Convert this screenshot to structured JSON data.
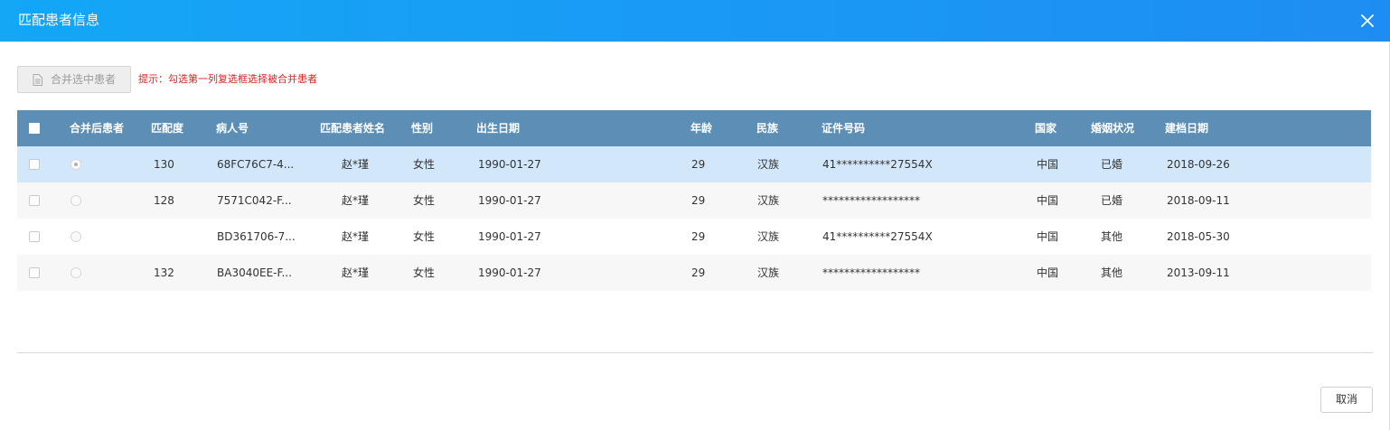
{
  "dialog": {
    "title": "匹配患者信息",
    "close_icon": "close-icon"
  },
  "toolbar": {
    "merge_label": "合并选中患者",
    "merge_icon": "document-icon",
    "hint": "提示：勾选第一列复选框选择被合并患者"
  },
  "table": {
    "headers": {
      "merged": "合并后患者",
      "match": "匹配度",
      "patient_no": "病人号",
      "name": "匹配患者姓名",
      "gender": "性别",
      "dob": "出生日期",
      "age": "年龄",
      "ethnicity": "民族",
      "id_no": "证件号码",
      "country": "国家",
      "marital": "婚姻状况",
      "created": "建档日期"
    },
    "rows": [
      {
        "match": "130",
        "patient_no": "68FC76C7-4...",
        "name": "赵*瑾",
        "gender": "女性",
        "dob": "1990-01-27",
        "age": "29",
        "ethnicity": "汉族",
        "id_no": "41**********27554X",
        "country": "中国",
        "marital": "已婚",
        "created": "2018-09-26"
      },
      {
        "match": "128",
        "patient_no": "7571C042-F...",
        "name": "赵*瑾",
        "gender": "女性",
        "dob": "1990-01-27",
        "age": "29",
        "ethnicity": "汉族",
        "id_no": "******************",
        "country": "中国",
        "marital": "已婚",
        "created": "2018-09-11"
      },
      {
        "match": "",
        "patient_no": "BD361706-7...",
        "name": "赵*瑾",
        "gender": "女性",
        "dob": "1990-01-27",
        "age": "29",
        "ethnicity": "汉族",
        "id_no": "41**********27554X",
        "country": "中国",
        "marital": "其他",
        "created": "2018-05-30"
      },
      {
        "match": "132",
        "patient_no": "BA3040EE-F...",
        "name": "赵*瑾",
        "gender": "女性",
        "dob": "1990-01-27",
        "age": "29",
        "ethnicity": "汉族",
        "id_no": "******************",
        "country": "中国",
        "marital": "其他",
        "created": "2013-09-11"
      }
    ]
  },
  "footer": {
    "cancel_label": "取消"
  },
  "colors": {
    "title_bar": "#1e8df3",
    "header_bg": "#5d8eb6",
    "selected_row": "#d3e7fb",
    "hint_text": "#e02020"
  }
}
